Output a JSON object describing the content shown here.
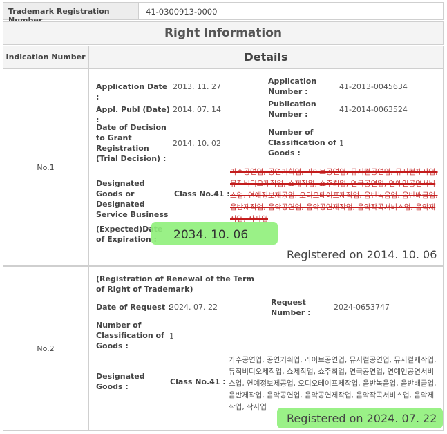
{
  "header": {
    "reg_number_label": "Trademark Registration Number",
    "reg_number_value": "41-0300913-0000"
  },
  "section_title": "Right Information",
  "columns": {
    "indication": "Indication Number",
    "details": "Details"
  },
  "entries": [
    {
      "number": "No.1",
      "application_date": {
        "label": "Application Date :",
        "value": "2013. 11. 27"
      },
      "application_number": {
        "label": "Application Number :",
        "value": "41-2013-0045634"
      },
      "appl_publ_date": {
        "label": "Appl. Publ (Date) :",
        "value": "2014. 07. 14"
      },
      "publication_number": {
        "label": "Publication Number :",
        "value": "41-2014-0063524"
      },
      "grant_decision": {
        "label": "Date of Decision to Grant Registration (Trial Decision) :",
        "value": "2014. 10. 02"
      },
      "num_classification": {
        "label": "Number of Classification of Goods :",
        "value": "1"
      },
      "designated_goods": {
        "label": "Designated Goods or Designated Service Business",
        "class": "Class No.41 :",
        "text": "가수공연업, 공연기획업, 라이브공연업, 뮤지컬공연업, 뮤지컬제작업, 뮤직비디오제작업, 쇼제작업, 쇼주최업, 연극공연업, 연예인공연서비스업, 연예정보제공업, 오디오테이프제작업, 음반녹음업, 음반배급업, 음반제작업, 음악공연업, 음악공연제작업, 음악작곡서비스업, 음악제작업, 작사업",
        "struck": true
      },
      "expiration": {
        "label": "(Expected)Date of Expiration :",
        "value": "2034. 10. 06"
      },
      "registered": "Registered on 2014. 10. 06"
    },
    {
      "number": "No.2",
      "renewal_title": "(Registration of Renewal of the Term of Right of Trademark)",
      "date_of_request": {
        "label": "Date of Request :",
        "value": "2024. 07. 22"
      },
      "request_number": {
        "label": "Request Number :",
        "value": "2024-0653747"
      },
      "num_classification": {
        "label": "Number of Classification of Goods :",
        "value": "1"
      },
      "designated_goods": {
        "label": "Designated Goods :",
        "class": "Class No.41 :",
        "text": "가수공연업, 공연기획업, 라이브공연업, 뮤지컬공연업, 뮤지컬제작업, 뮤직비디오제작업, 쇼제작업, 쇼주최업, 연극공연업, 연예인공연서비스업, 연예정보제공업, 오디오테이프제작업, 음반녹음업, 음반배급업, 음반제작업, 음악공연업, 음악공연제작업, 음악작곡서비스업, 음악제작업, 작사업",
        "struck": false
      },
      "registered": "Registered on 2024. 07. 22"
    }
  ]
}
